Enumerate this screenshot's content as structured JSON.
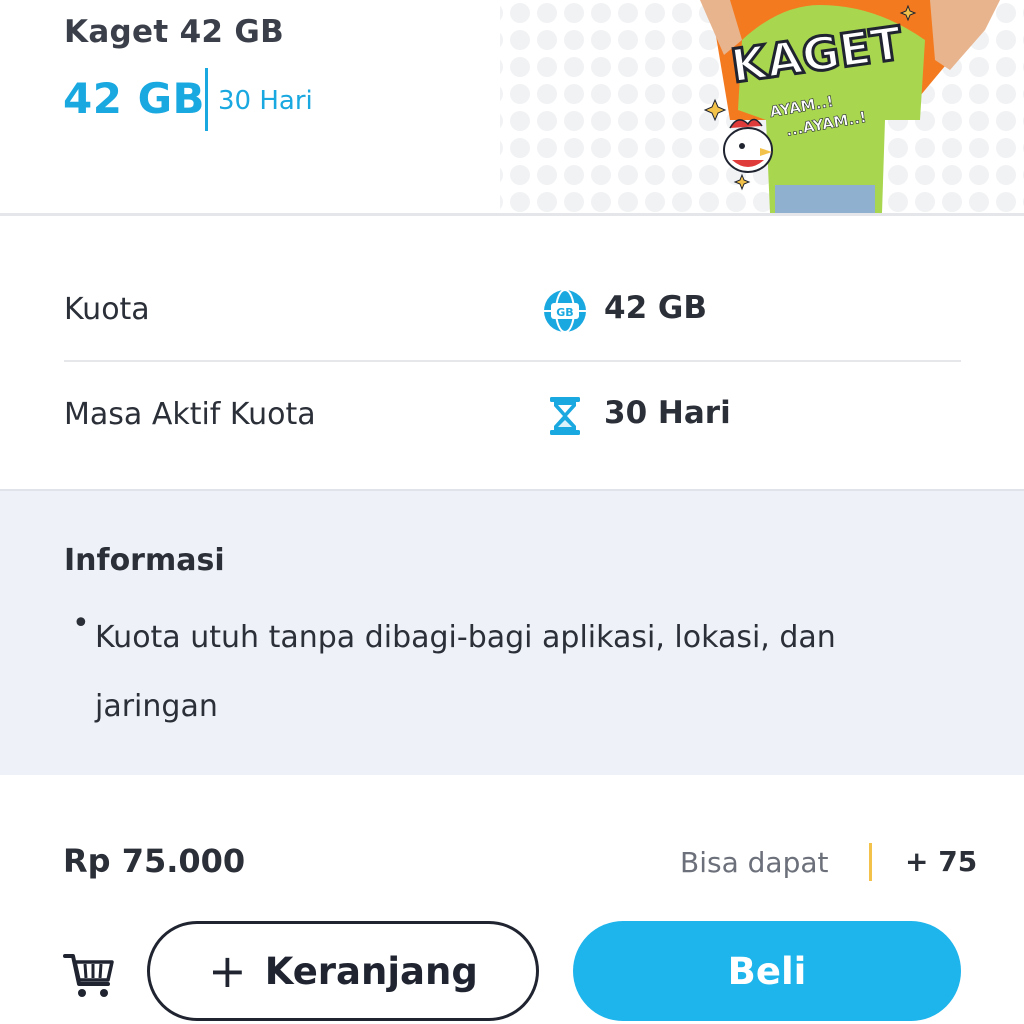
{
  "header": {
    "package_name": "Kaget 42 GB",
    "quota": "42 GB",
    "active_period": "30 Hari",
    "banner": {
      "text_big": "KAGET",
      "text_small_1": "AYAM..!",
      "text_small_2": "...AYAM..!",
      "colors": {
        "orange": "#f47a20",
        "shirt": "#a9d64f"
      }
    }
  },
  "details": [
    {
      "label": "Kuota",
      "icon": "globe-gb-icon",
      "value": "42 GB"
    },
    {
      "label": "Masa Aktif Kuota",
      "icon": "hourglass-icon",
      "value": "30 Hari"
    }
  ],
  "info": {
    "title": "Informasi",
    "items": [
      "Kuota utuh tanpa dibagi-bagi aplikasi, lokasi, dan jaringan"
    ]
  },
  "footer": {
    "price": "Rp 75.000",
    "bonus_label": "Bisa dapat",
    "bonus_points": "+ 75",
    "cart_icon": "cart-icon",
    "add_to_cart_label": "Keranjang",
    "buy_label": "Beli"
  },
  "colors": {
    "accent": "#1aa8e0",
    "buy_button": "#1eb4ec",
    "info_bg": "#eef2f8",
    "points_divider": "#f3c24a"
  }
}
